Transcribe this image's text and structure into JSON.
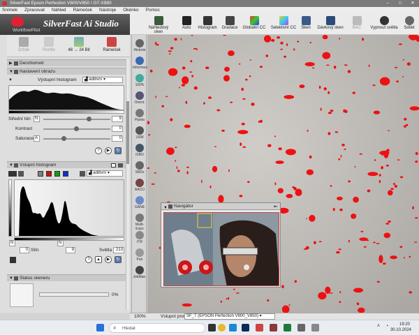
{
  "window": {
    "title": "SilverFast  Epson Perfection V800/V850 / GT-X980"
  },
  "menubar": {
    "items": [
      "Snímek",
      "Zpracovat",
      "Náhled",
      "Rámeček",
      "Nástroje",
      "Okénko",
      "Pomoc"
    ]
  },
  "brand": {
    "logo_text": "SilverFast Ai Studio",
    "workflowpilot": "WorkflowPilot"
  },
  "toolbar": {
    "buttons": [
      {
        "label": "Náhledový sken",
        "icon": "prescan-icon"
      },
      {
        "label": "Auto",
        "icon": "auto-icon"
      },
      {
        "label": "Histogram",
        "icon": "histogram-icon"
      },
      {
        "label": "Gradace",
        "icon": "gradation-icon"
      },
      {
        "label": "Globální CC",
        "icon": "global-cc-icon"
      },
      {
        "label": "Selektivní CC",
        "icon": "selective-cc-icon"
      },
      {
        "label": "Sken",
        "icon": "scan-icon"
      },
      {
        "label": "Dávkový sken",
        "icon": "batch-scan-icon"
      },
      {
        "label": "BAC",
        "icon": "bac-icon"
      },
      {
        "label": "Vypnout světla",
        "icon": "lights-off-icon"
      },
      {
        "label": "Sdílet",
        "icon": "share-icon"
      }
    ]
  },
  "mode": {
    "buttons": [
      {
        "label": "Držák",
        "icon": "holder-icon"
      },
      {
        "label": "Pozitiv",
        "icon": "positive-icon"
      },
      {
        "label": "48 → 24 Bit",
        "icon": "bitdepth-icon"
      },
      {
        "label": "Rámeček",
        "icon": "frame-icon"
      }
    ]
  },
  "densitometer": {
    "title": "Denzitometr"
  },
  "image_settings": {
    "title": "Nastavení obrazu",
    "output_hist_label": "Výstupní histogram",
    "output_mode": "aditivní",
    "midtone_label": "Střední tón",
    "midtone_key": "N",
    "midtone_value": "9",
    "contrast_label": "Kontrast",
    "contrast_value": "0",
    "saturation_label": "Saturace",
    "saturation_key": "A",
    "saturation_value": "0"
  },
  "input_histogram": {
    "title": "Vstupní histogram",
    "mode": "aditivní",
    "channel_colors": [
      "#808080",
      "#d01010",
      "#10a010",
      "#1030d0"
    ],
    "left_key": "N",
    "right_key": "N",
    "shadow_value": "0",
    "shadow_label": "Stín",
    "mid_value": "9",
    "highlight_label": "Světla",
    "highlight_value": "213"
  },
  "scanner_status": {
    "title": "Status skeneru",
    "progress_pct": "0%",
    "progress": 0
  },
  "sidetools": [
    {
      "label": "Historie"
    },
    {
      "label": "Informace"
    },
    {
      "label": "100%"
    },
    {
      "label": "Orient."
    },
    {
      "label": "Pipeta"
    },
    {
      "label": "USM"
    },
    {
      "label": "iSRD"
    },
    {
      "label": "SRDx"
    },
    {
      "label": "AACO"
    },
    {
      "label": "GANE"
    },
    {
      "label": "Multi-Expo"
    },
    {
      "label": "ITR"
    },
    {
      "label": "Pan"
    },
    {
      "label": "JobMan."
    }
  ],
  "navigator": {
    "title": "Navigátor"
  },
  "statusbar": {
    "zoom": "100%",
    "profile_label": "Vstupní profil:",
    "profile_value": "SF_T (EPSON Perfection V800_V850)"
  },
  "taskbar": {
    "search_placeholder": "Hledat",
    "time": "19:20",
    "date": "30.10.2024"
  }
}
